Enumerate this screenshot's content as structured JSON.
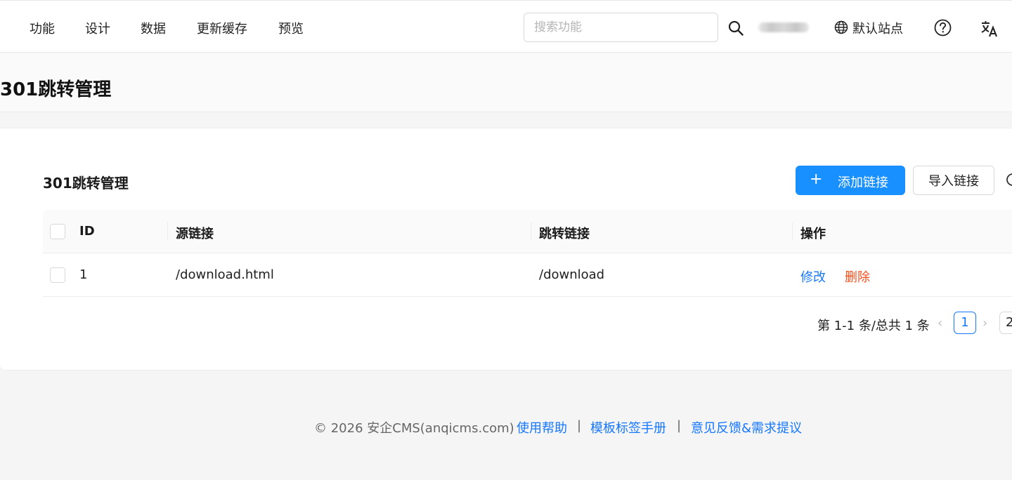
{
  "topbar": {
    "nav": [
      "功能",
      "设计",
      "数据",
      "更新缓存",
      "预览"
    ],
    "search_placeholder": "搜索功能",
    "search_value": "",
    "site_label": "默认站点",
    "icons": [
      "search-icon",
      "globe-icon",
      "help-circle-icon",
      "translate-icon"
    ]
  },
  "page": {
    "title": "301跳转管理"
  },
  "card": {
    "title": "301跳转管理",
    "add_button": "添加链接",
    "import_button": "导入链接",
    "table": {
      "headers": [
        "ID",
        "源链接",
        "跳转链接",
        "操作"
      ],
      "rows": [
        {
          "id": "1",
          "source": "/download.html",
          "target": "/download",
          "edit": "修改",
          "delete": "删除"
        }
      ]
    },
    "pagination": {
      "total_text": "第 1-1 条/总共 1 条",
      "current_page": "1",
      "page_size_partial": "2"
    }
  },
  "footer": {
    "copyright": "© 2026 安企CMS(anqicms.com)",
    "links": [
      "使用帮助",
      "模板标签手册",
      "意见反馈&需求提议"
    ],
    "separator": "|"
  },
  "colors": {
    "primary": "#1890ff",
    "link": "#1677ff",
    "danger": "#ff4d1a",
    "background": "#f5f5f5"
  }
}
